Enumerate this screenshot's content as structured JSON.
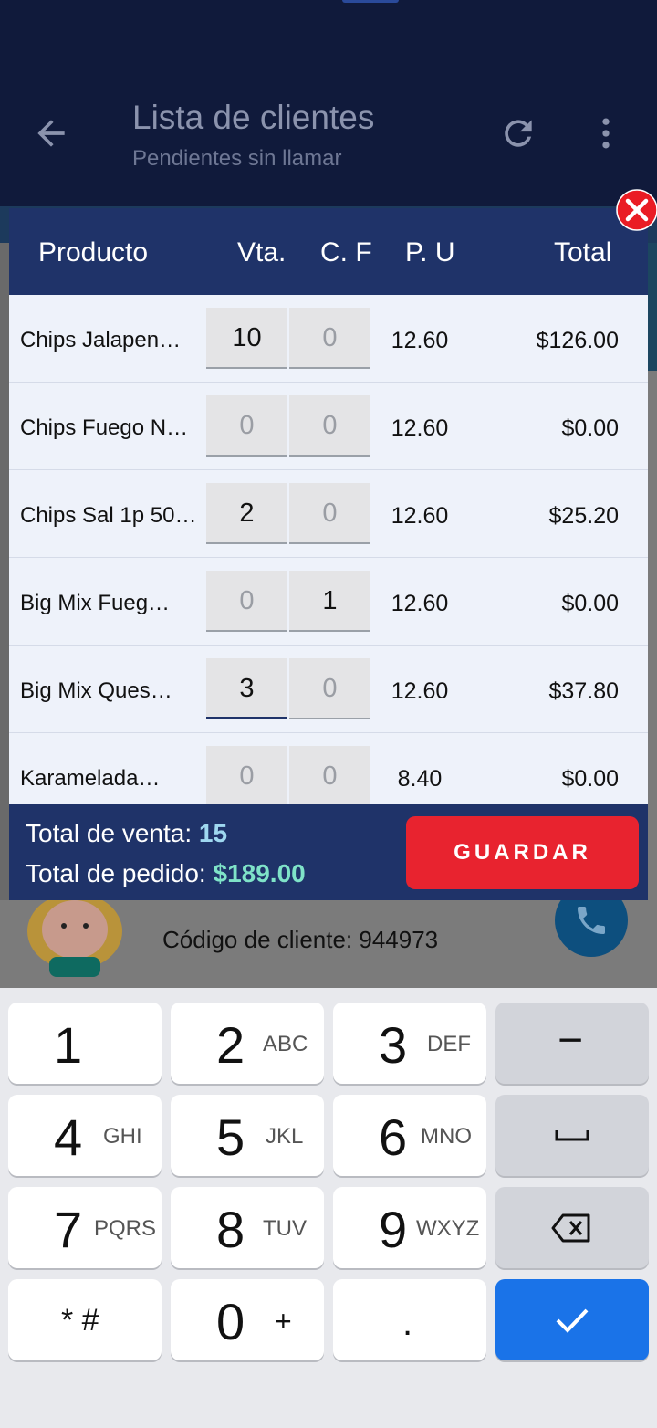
{
  "appbar": {
    "title": "Lista de clientes",
    "subtitle": "Pendientes sin llamar",
    "icons": [
      "arrow-back-icon",
      "refresh-icon",
      "more-vert-icon"
    ]
  },
  "background": {
    "client_code_label": "Código de cliente: 944973"
  },
  "dialog": {
    "headers": {
      "producto": "Producto",
      "vta": "Vta.",
      "cf": "C. F",
      "pu": "P. U",
      "total": "Total"
    },
    "rows": [
      {
        "name": "Chips Jalapen…",
        "vta": "10",
        "cf": "0",
        "pu": "12.60",
        "total": "$126.00"
      },
      {
        "name": "Chips Fuego N…",
        "vta": "0",
        "cf": "0",
        "pu": "12.60",
        "total": "$0.00"
      },
      {
        "name": "Chips Sal 1p 50…",
        "vta": "2",
        "cf": "0",
        "pu": "12.60",
        "total": "$25.20"
      },
      {
        "name": "Big Mix Fueg…",
        "vta": "0",
        "cf": "1",
        "pu": "12.60",
        "total": "$0.00"
      },
      {
        "name": "Big Mix Ques…",
        "vta": "3",
        "cf": "0",
        "pu": "12.60",
        "total": "$37.80"
      },
      {
        "name": "Karamelada…",
        "vta": "0",
        "cf": "0",
        "pu": "8.40",
        "total": "$0.00"
      }
    ],
    "footer": {
      "total_venta_label": "Total de venta: ",
      "total_venta_value": "15",
      "total_pedido_label": "Total de pedido: ",
      "total_pedido_value": "$189.00",
      "save_label": "GUARDAR"
    }
  },
  "keyboard": {
    "keys": [
      {
        "d": "1",
        "l": ""
      },
      {
        "d": "2",
        "l": "ABC"
      },
      {
        "d": "3",
        "l": "DEF"
      },
      {
        "d": "−",
        "l": ""
      },
      {
        "d": "4",
        "l": "GHI"
      },
      {
        "d": "5",
        "l": "JKL"
      },
      {
        "d": "6",
        "l": "MNO"
      },
      {
        "d": "␣",
        "l": ""
      },
      {
        "d": "7",
        "l": "PQRS"
      },
      {
        "d": "8",
        "l": "TUV"
      },
      {
        "d": "9",
        "l": "WXYZ"
      },
      {
        "d": "⌫",
        "l": ""
      },
      {
        "d": "* #",
        "l": ""
      },
      {
        "d": "0",
        "l": "+"
      },
      {
        "d": ".",
        "l": ""
      },
      {
        "d": "✓",
        "l": ""
      }
    ]
  },
  "colors": {
    "appbar": "#101a3b",
    "dialog_header": "#1f3369",
    "save_button": "#e8232f",
    "enter_key": "#1a73e8",
    "pedido_total": "#7fe3c8"
  }
}
